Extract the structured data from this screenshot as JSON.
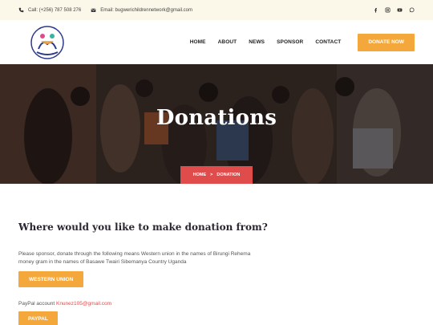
{
  "topbar": {
    "phone": "Call: (+256) 787 508 276",
    "email": "Email: bugwerichildrennetwork@gmail.com",
    "socials": [
      "facebook-icon",
      "instagram-icon",
      "youtube-icon",
      "whatsapp-icon"
    ]
  },
  "nav": {
    "items": [
      "HOME",
      "ABOUT",
      "NEWS",
      "SPONSOR",
      "CONTACT"
    ],
    "donate_label": "DONATE NOW"
  },
  "hero": {
    "title": "Donations",
    "breadcrumb": {
      "home": "HOME",
      "sep": ">",
      "current": "DONATION"
    }
  },
  "main": {
    "heading": "Where would you like to make donation from?",
    "description": "Please sponsor, donate through the following means Western union in the names of Birungi Rehema money gram in the names of Basawe Twairi Sibemanya Country Uganda",
    "western_union_label": "WESTERN UNION",
    "paypal_prefix": "PayPal account",
    "paypal_email": "Knunez105@gmail.com",
    "paypal_label": "PAYPAL"
  },
  "colors": {
    "accent": "#f4a73b",
    "red": "#e04b4b",
    "topbar_bg": "#fbf7e9"
  }
}
